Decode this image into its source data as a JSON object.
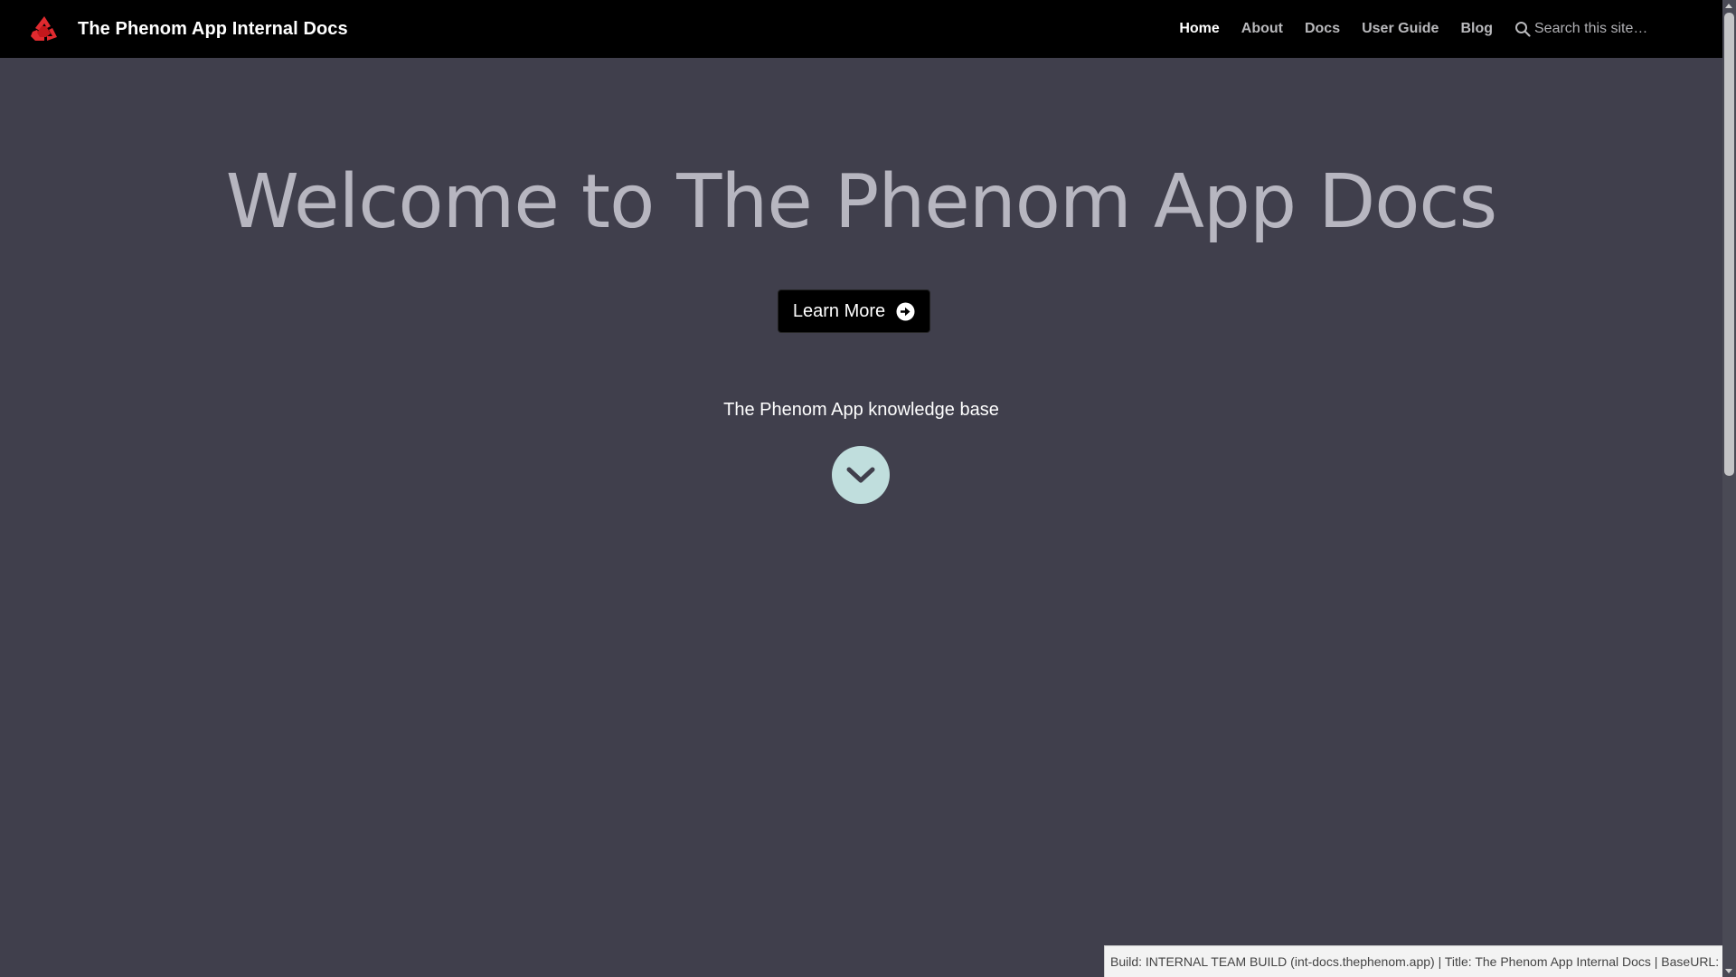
{
  "navbar": {
    "brand_title": "The Phenom App Internal Docs",
    "links": [
      {
        "label": "Home",
        "active": true
      },
      {
        "label": "About",
        "active": false
      },
      {
        "label": "Docs",
        "active": false
      },
      {
        "label": "User Guide",
        "active": false
      },
      {
        "label": "Blog",
        "active": false
      }
    ],
    "search_placeholder": "Search this site…",
    "logo_icon": "recycle-logo-icon",
    "logo_color": "#e02a2f"
  },
  "hero": {
    "title": "Welcome to The Phenom App Docs",
    "cta_label": "Learn More",
    "cta_icon": "arrow-circle-right-icon",
    "tagline": "The Phenom App knowledge base",
    "scroll_icon": "chevron-down-icon"
  },
  "footer": {
    "build_info": "Build: INTERNAL TEAM BUILD (int-docs.thephenom.app) | Title: The Phenom App Internal Docs | BaseURL:"
  },
  "colors": {
    "background": "#403f4c",
    "navbar": "#000000",
    "accent_circle": "#c0dedd"
  }
}
